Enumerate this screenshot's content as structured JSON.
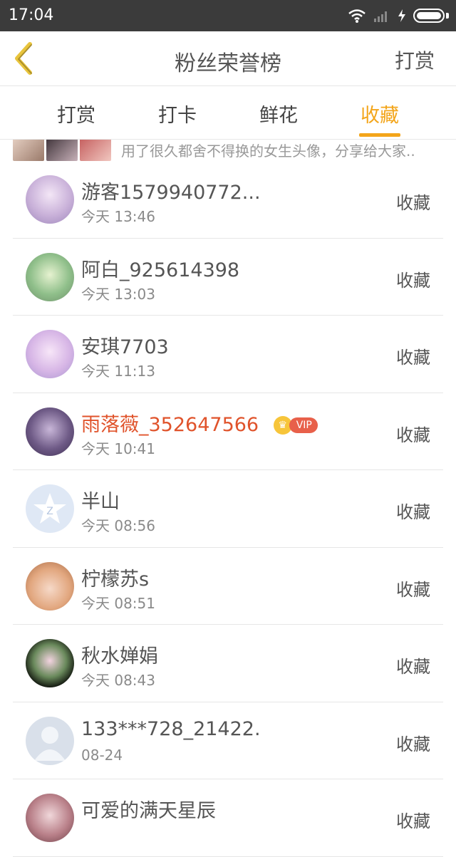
{
  "status": {
    "time": "17:04"
  },
  "nav": {
    "title": "粉丝荣誉榜",
    "action": "打赏"
  },
  "tabs": [
    {
      "label": "打赏"
    },
    {
      "label": "打卡"
    },
    {
      "label": "鲜花"
    },
    {
      "label": "收藏",
      "active": true
    }
  ],
  "banner": {
    "text": "用了很久都舍不得换的女生头像，分享给大家.."
  },
  "colors": {
    "accent": "#f3a51a",
    "vip_name": "#e0532b"
  },
  "users": [
    {
      "name": "游客1579940772...",
      "time": "今天 13:46",
      "action": "收藏"
    },
    {
      "name": "阿白_925614398",
      "time": "今天 13:03",
      "action": "收藏"
    },
    {
      "name": "安琪7703",
      "time": "今天 11:13",
      "action": "收藏"
    },
    {
      "name": "雨落薇_352647566",
      "time": "今天 10:41",
      "action": "收藏",
      "badge": "VIP"
    },
    {
      "name": "半山",
      "time": "今天 08:56",
      "action": "收藏"
    },
    {
      "name": "柠檬苏s",
      "time": "今天 08:51",
      "action": "收藏"
    },
    {
      "name": "秋水婵娟",
      "time": "今天 08:43",
      "action": "收藏"
    },
    {
      "name": "133***728_21422.",
      "time": "08-24",
      "action": "收藏"
    },
    {
      "name": "可爱的满天星辰",
      "time": "",
      "action": "收藏"
    }
  ]
}
